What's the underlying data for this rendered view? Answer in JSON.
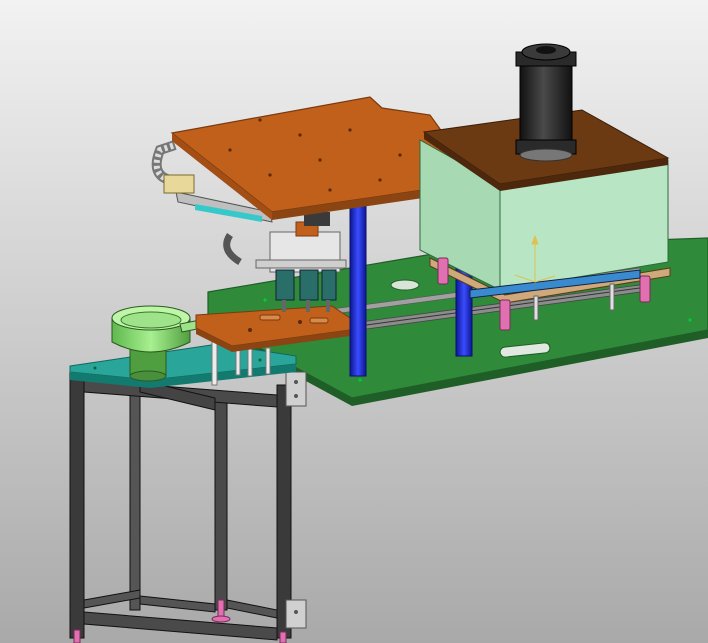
{
  "scene": {
    "kind": "cad-viewport",
    "colors": {
      "background_light": "#f2f2f2",
      "background_dark": "#a9a9a9",
      "copper_plate": "#c0601a",
      "copper_edge": "#7a3a10",
      "green_baseplate": "#2f8a3a",
      "green_edge": "#1f5f27",
      "teal_table": "#2aa59a",
      "blue_column": "#1a2acc",
      "mint_enclosure": "#b8e6c4",
      "brown_lid": "#6b3a12",
      "black_cylinder": "#1c1c1c",
      "lime_bowl": "#8fe07a",
      "pink_spring": "#e070b0",
      "frame_steel": "#3a3a3a",
      "rail_grey": "#8c8c8c"
    }
  }
}
